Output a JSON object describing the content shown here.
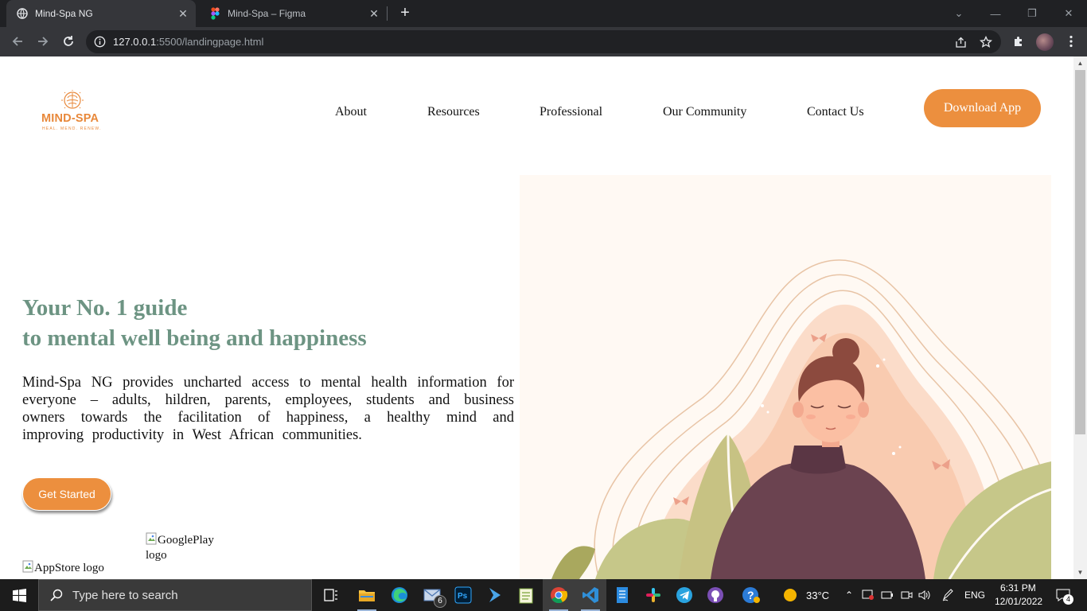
{
  "browser": {
    "tabs": [
      {
        "title": "Mind-Spa NG",
        "active": true,
        "icon": "globe-icon"
      },
      {
        "title": "Mind-Spa – Figma",
        "active": false,
        "icon": "figma-icon"
      }
    ],
    "url_host": "127.0.0.1",
    "url_rest": ":5500/landingpage.html"
  },
  "page": {
    "logo": {
      "word": "MIND-SPA",
      "tagline": "HEAL. MEND. RENEW."
    },
    "nav": [
      {
        "label": "About"
      },
      {
        "label": "Resources"
      },
      {
        "label": "Professional"
      },
      {
        "label": "Our Community"
      },
      {
        "label": "Contact Us"
      }
    ],
    "download_button": "Download App",
    "hero": {
      "title_line1": "Your No. 1 guide",
      "title_line2": "to mental well being and happiness",
      "description": "Mind-Spa NG provides uncharted access to mental health information for everyone – adults, hildren, parents, employees, students and business owners towards the facilitation of happiness, a healthy mind and improving productivity in West African communities.",
      "cta": "Get Started",
      "googleplay_alt": "GooglePlay logo",
      "appstore_alt": "AppStore logo"
    },
    "colors": {
      "accent": "#ec8f3e",
      "heading": "#6d9483"
    }
  },
  "taskbar": {
    "search_placeholder": "Type here to search",
    "mail_badge": "6",
    "temperature": "33°C",
    "language": "ENG",
    "time": "6:31 PM",
    "date": "12/01/2022",
    "notifications": "4"
  }
}
